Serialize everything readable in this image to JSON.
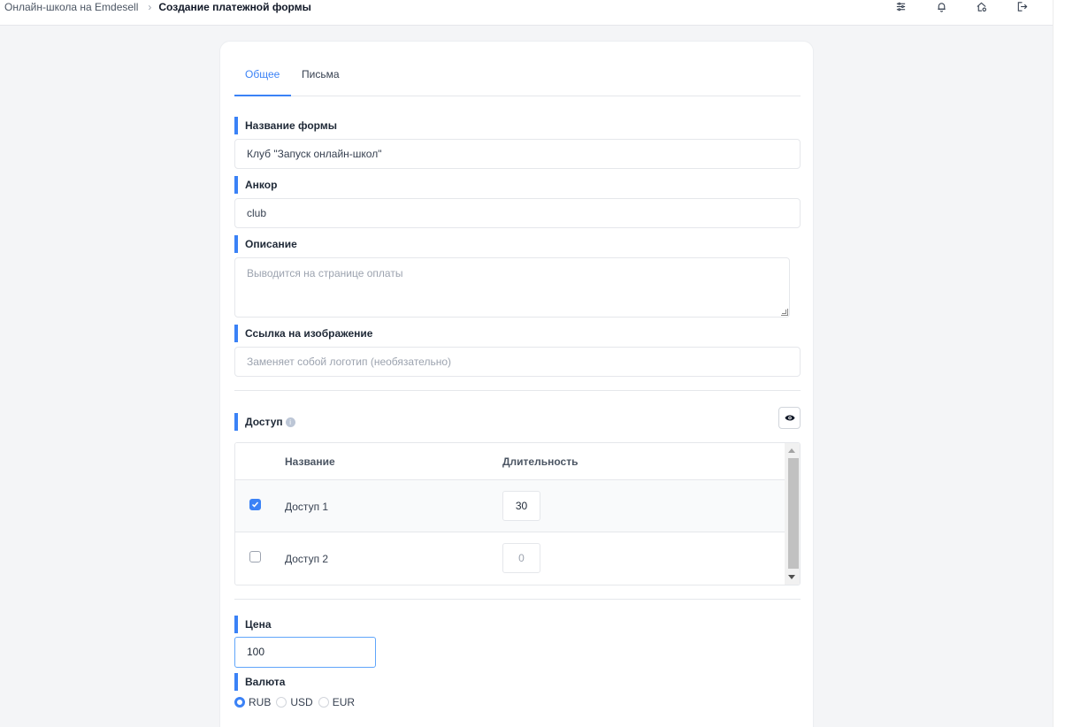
{
  "breadcrumb": {
    "parent": "Онлайн-школа на Emdesell",
    "current": "Создание платежной формы"
  },
  "topbar_icons": [
    "sliders-icon",
    "bell-icon",
    "home-gear-icon",
    "logout-icon"
  ],
  "tabs": [
    {
      "label": "Общее",
      "active": true
    },
    {
      "label": "Письма",
      "active": false
    }
  ],
  "form": {
    "name_label": "Название формы",
    "name_value": "Клуб \"Запуск онлайн-школ\"",
    "anchor_label": "Анкор",
    "anchor_value": "club",
    "description_label": "Описание",
    "description_placeholder": "Выводится на странице оплаты",
    "image_label": "Ссылка на изображение",
    "image_placeholder": "Заменяет собой логотип (необязательно)"
  },
  "access": {
    "label": "Доступ",
    "info_glyph": "i",
    "columns": [
      "Название",
      "Длительность"
    ],
    "rows": [
      {
        "name": "Доступ 1",
        "checked": true,
        "duration": "30"
      },
      {
        "name": "Доступ 2",
        "checked": false,
        "duration": "0"
      }
    ]
  },
  "price": {
    "label": "Цена",
    "value": "100"
  },
  "currency": {
    "label": "Валюта",
    "options": [
      "RUB",
      "USD",
      "EUR"
    ],
    "selected": "RUB"
  },
  "colors": {
    "accent": "#3b82f6",
    "background": "#f4f5f7"
  }
}
